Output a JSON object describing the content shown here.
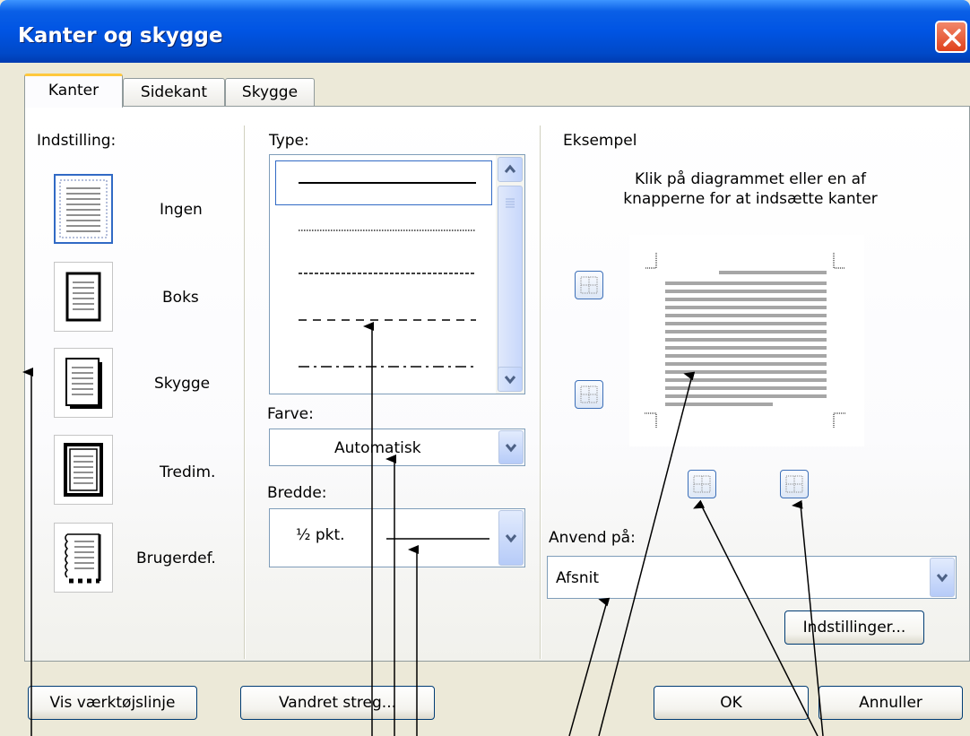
{
  "window": {
    "title": "Kanter og skygge"
  },
  "tabs": [
    {
      "label": "Kanter",
      "active": true
    },
    {
      "label": "Sidekant",
      "active": false
    },
    {
      "label": "Skygge",
      "active": false
    }
  ],
  "setting": {
    "heading": "Indstilling:",
    "items": [
      {
        "label": "Ingen",
        "selected": true
      },
      {
        "label": "Boks"
      },
      {
        "label": "Skygge"
      },
      {
        "label": "Tredim."
      },
      {
        "label": "Brugerdef."
      }
    ]
  },
  "style": {
    "type_label": "Type:",
    "line_styles": [
      "solid",
      "dotted",
      "dashed-small",
      "dashed",
      "dash-dot"
    ],
    "color_label": "Farve:",
    "color_value": "Automatisk",
    "width_label": "Bredde:",
    "width_value": "½ pkt."
  },
  "preview": {
    "heading": "Eksempel",
    "hint": "Klik på diagrammet eller en af knapperne for at indsætte kanter",
    "apply_label": "Anvend på:",
    "apply_value": "Afsnit",
    "options_button": "Indstillinger..."
  },
  "buttons": {
    "toolbar": "Vis værktøjslinje",
    "horizontal_line": "Vandret streg...",
    "ok": "OK",
    "cancel": "Annuller"
  },
  "colors": {
    "titlebar": "#0054e3",
    "dialog_bg": "#ece9d8",
    "accent_tab": "#ffc83c",
    "close": "#e0421c"
  }
}
